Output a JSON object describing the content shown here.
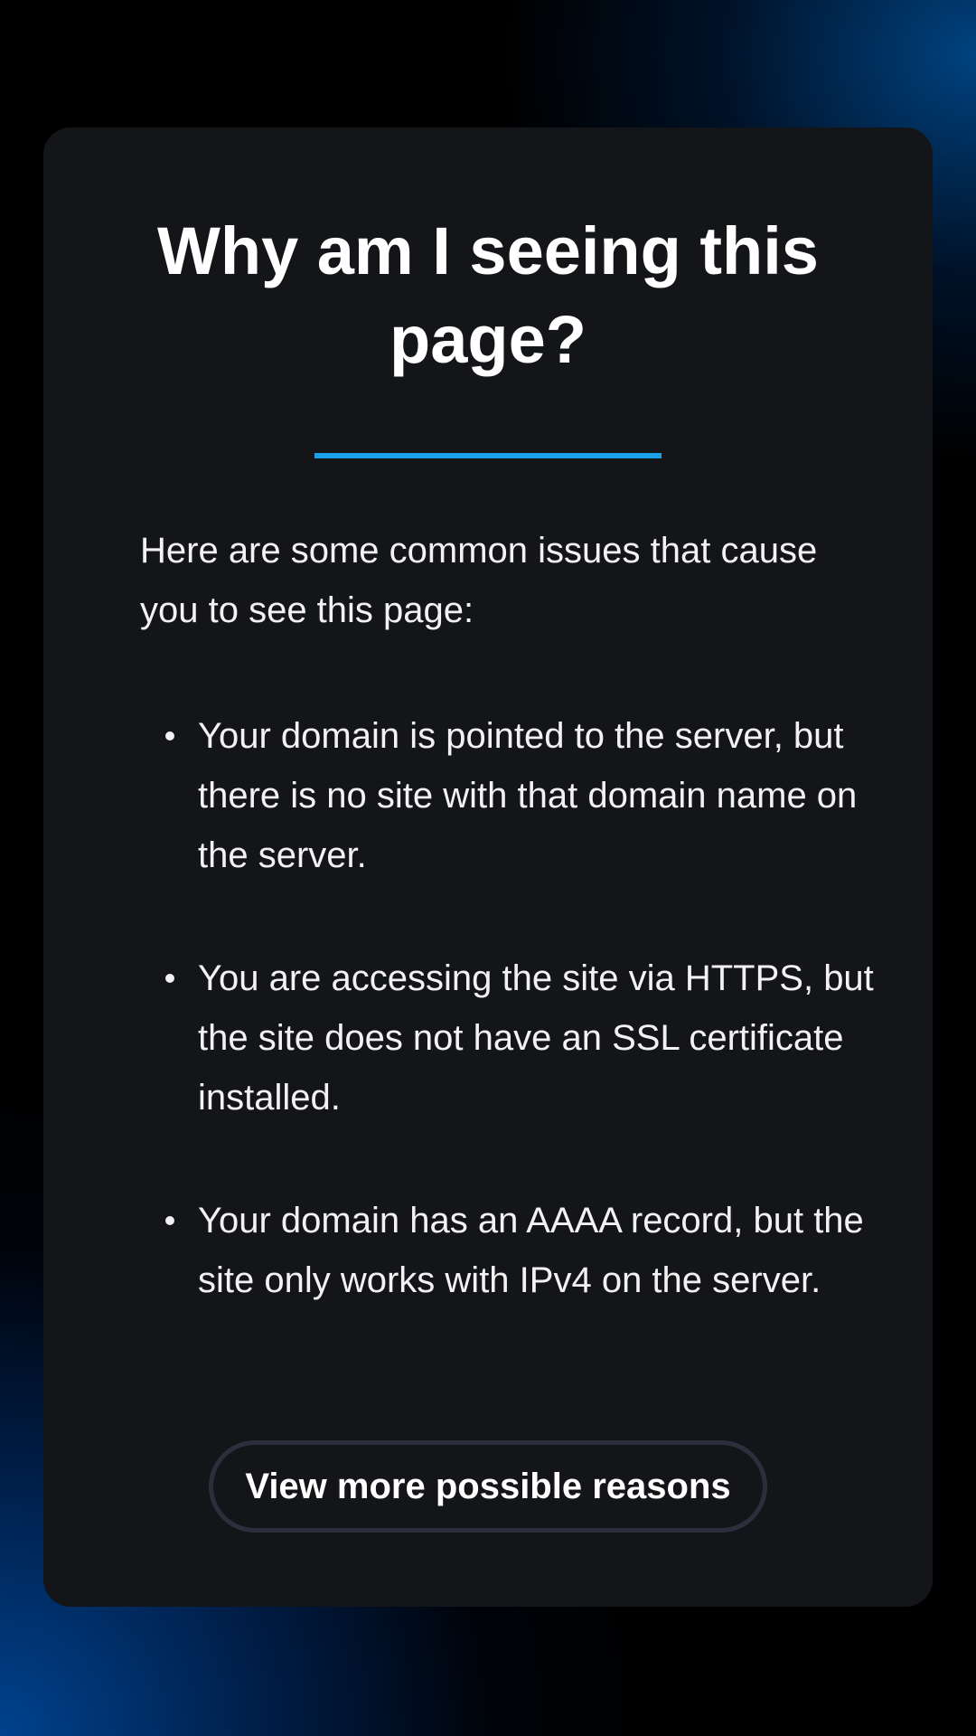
{
  "page": {
    "title_line_1": "Why am I seeing this",
    "title_line_2": "page?",
    "intro": "Here are some common issues that cause you to see this page:",
    "reasons": [
      {
        "text": "Your domain is pointed to the server, but there is no site with that domain name on the server."
      },
      {
        "text": "You are accessing the site via HTTPS, but the site does not have an SSL certificate installed."
      },
      {
        "text": "Your domain has an AAAA record, but the site only works with IPv4 on the server."
      }
    ],
    "more_button_label": "View more possible reasons"
  },
  "colors": {
    "card_background": "#141519",
    "accent": "#1a9ee6",
    "text": "#f2f2f2",
    "button_border": "#2b2f3b"
  }
}
